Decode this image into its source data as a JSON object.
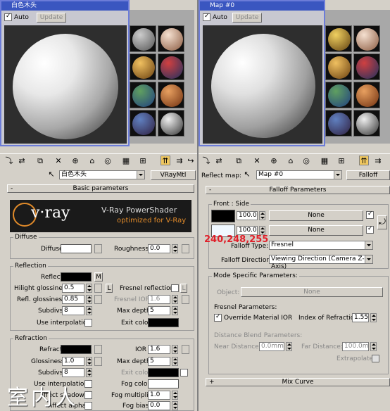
{
  "left": {
    "window_title": "白色木头",
    "auto_label": "Auto",
    "update_label": "Update",
    "material_name": "白色木头",
    "material_type": "VRayMtl",
    "basic_params_title": "Basic parameters",
    "vray": {
      "logo": "v·ray",
      "title": "V-Ray PowerShader",
      "subtitle": "optimized for V-Ray"
    },
    "diffuse": {
      "group": "Diffuse",
      "label": "Diffuse",
      "roughness_label": "Roughness",
      "roughness": "0.0"
    },
    "reflection": {
      "group": "Reflection",
      "reflect_label": "Reflect",
      "m_label": "M",
      "hilight_label": "Hilight glossiness",
      "hilight": "0.5",
      "l_label": "L",
      "fresnel_label": "Fresnel reflections",
      "refl_gloss_label": "Refl. glossiness",
      "refl_gloss": "0.85",
      "fresnel_ior_label": "Fresnel IOR",
      "fresnel_ior": "1.6",
      "subdivs_label": "Subdivs",
      "subdivs": "8",
      "max_depth_label": "Max depth",
      "max_depth": "5",
      "use_interp_label": "Use interpolation",
      "exit_color_label": "Exit color"
    },
    "refraction": {
      "group": "Refraction",
      "refract_label": "Refract",
      "ior_label": "IOR",
      "ior": "1.6",
      "glossiness_label": "Glossiness",
      "glossiness": "1.0",
      "max_depth_label": "Max depth",
      "max_depth": "5",
      "subdivs_label": "Subdivs",
      "subdivs": "8",
      "exit_color_label": "Exit color",
      "use_interp_label": "Use interpolation",
      "fog_color_label": "Fog color",
      "affect_shadows_label": "Affect shadows",
      "fog_mult_label": "Fog multiplier",
      "fog_mult": "1.0",
      "affect_alpha_label": "Affect alpha",
      "fog_bias_label": "Fog bias",
      "fog_bias": "0.0"
    }
  },
  "right": {
    "window_title": "Map #0",
    "auto_label": "Auto",
    "update_label": "Update",
    "reflect_map_label": "Reflect map:",
    "map_name": "Map #0",
    "map_type": "Falloff",
    "falloff_title": "Falloff Parameters",
    "front_side_label": "Front : Side",
    "val1": "100.0",
    "val2": "100.0",
    "none_label": "None",
    "color_readout": "240,248,255",
    "falloff_type_label": "Falloff Type:",
    "falloff_type": "Fresnel",
    "falloff_dir_label": "Falloff Direction:",
    "falloff_dir": "Viewing Direction (Camera Z-Axis)",
    "mode_title": "Mode Specific Parameters:",
    "object_label": "Object:",
    "fresnel_params_label": "Fresnel Parameters:",
    "override_ior_label": "Override Material IOR",
    "ior_label": "Index of Refraction",
    "ior": "1.55",
    "dist_blend_label": "Distance Blend Parameters:",
    "near_label": "Near Distance:",
    "near": "0.0mm",
    "far_label": "Far Distance:",
    "far": "100.0mm",
    "extrapolate_label": "Extrapolate",
    "mix_curve_label": "Mix Curve"
  },
  "watermark": "室内人",
  "colors": {
    "title_blue": "#3a56c0",
    "readout_red": "#e0202a",
    "panel_gray": "#d4d0c8",
    "near_white": "#f0f8ff"
  }
}
